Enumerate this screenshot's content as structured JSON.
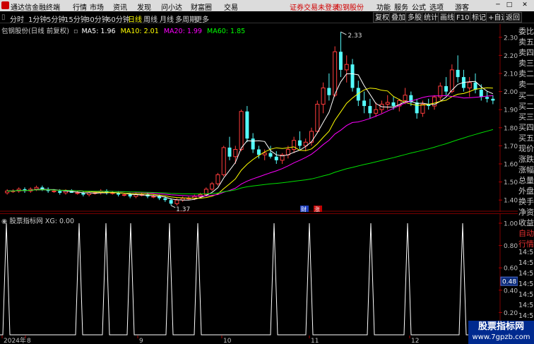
{
  "app": {
    "title": "通达信金融终端",
    "menu": [
      "行情",
      "市场",
      "资讯",
      "发现",
      "问小达",
      "财富圈",
      "交易"
    ],
    "login_notice": "证券交易未登录",
    "stock_name": "包钢股份",
    "right_menu": [
      "功能",
      "服务",
      "公式",
      "选项"
    ],
    "user": "游客"
  },
  "periods": {
    "items": [
      "分时",
      "1分钟",
      "5分钟",
      "15分钟",
      "30分钟",
      "60分钟",
      "日线",
      "周线",
      "月线",
      "多周期",
      "更多"
    ],
    "active": "日线"
  },
  "toolbar": {
    "buttons": [
      "复权",
      "叠加",
      "多股",
      "统计",
      "画线",
      "F10",
      "标记",
      "+自选",
      "返回"
    ]
  },
  "main_chart": {
    "title": "包钢股份(日线 前复权)",
    "ma_labels": [
      {
        "text": "MA5: 1.96",
        "color": "#ffffff"
      },
      {
        "text": "MA10: 2.01",
        "color": "#ffff00"
      },
      {
        "text": "MA20: 1.99",
        "color": "#ff00ff"
      },
      {
        "text": "MA60: 1.85",
        "color": "#00ff00"
      }
    ],
    "y_ticks": [
      "2.30",
      "2.20",
      "2.10",
      "2.00",
      "1.90",
      "1.80",
      "1.70",
      "1.60",
      "1.50",
      "1.40"
    ],
    "high_marker": "2.33",
    "low_marker": "1.37",
    "badge_cai": "财",
    "badge_zhang": "涨"
  },
  "indicator": {
    "title": "股票指标网  XG: 0.00",
    "y_ticks": [
      "1.00",
      "0.80",
      "0.60",
      "0.40",
      "0.20",
      "0.00"
    ],
    "value_box": "0.48"
  },
  "x_axis": {
    "labels": [
      "2024年",
      "8",
      "9",
      "10",
      "11",
      "12"
    ]
  },
  "right_panel": {
    "labels": [
      "委比",
      "卖五",
      "卖四",
      "卖三",
      "卖二",
      "卖一",
      "买一",
      "买二",
      "买三",
      "买四",
      "买五",
      "现价",
      "涨跌",
      "涨幅",
      "总量",
      "外盘",
      "换手",
      "净资",
      "收益",
      "自动",
      "行情",
      "14:56",
      "14:56",
      "14:56",
      "14:56",
      "14:56",
      "14:56",
      "14:56",
      "14:56"
    ]
  },
  "watermark": {
    "line1": "股票指标网",
    "line2": "www.7gpzb.com"
  },
  "chart_data": {
    "type": "candlestick",
    "title": "包钢股份(日线 前复权)",
    "ylim": [
      1.35,
      2.35
    ],
    "candles": [
      [
        1.44,
        1.46,
        1.43,
        1.45
      ],
      [
        1.45,
        1.46,
        1.44,
        1.45
      ],
      [
        1.45,
        1.47,
        1.44,
        1.46
      ],
      [
        1.46,
        1.47,
        1.44,
        1.45
      ],
      [
        1.45,
        1.47,
        1.44,
        1.46
      ],
      [
        1.46,
        1.48,
        1.45,
        1.47
      ],
      [
        1.47,
        1.48,
        1.45,
        1.46
      ],
      [
        1.46,
        1.47,
        1.44,
        1.45
      ],
      [
        1.45,
        1.46,
        1.44,
        1.45
      ],
      [
        1.45,
        1.46,
        1.43,
        1.44
      ],
      [
        1.44,
        1.46,
        1.43,
        1.45
      ],
      [
        1.45,
        1.46,
        1.44,
        1.44
      ],
      [
        1.44,
        1.45,
        1.43,
        1.44
      ],
      [
        1.44,
        1.45,
        1.42,
        1.43
      ],
      [
        1.43,
        1.45,
        1.42,
        1.44
      ],
      [
        1.44,
        1.45,
        1.43,
        1.44
      ],
      [
        1.44,
        1.46,
        1.43,
        1.45
      ],
      [
        1.45,
        1.46,
        1.43,
        1.44
      ],
      [
        1.44,
        1.45,
        1.43,
        1.44
      ],
      [
        1.44,
        1.45,
        1.42,
        1.43
      ],
      [
        1.43,
        1.44,
        1.42,
        1.43
      ],
      [
        1.43,
        1.44,
        1.41,
        1.42
      ],
      [
        1.42,
        1.44,
        1.41,
        1.43
      ],
      [
        1.43,
        1.44,
        1.42,
        1.43
      ],
      [
        1.43,
        1.44,
        1.41,
        1.42
      ],
      [
        1.42,
        1.43,
        1.41,
        1.42
      ],
      [
        1.42,
        1.43,
        1.4,
        1.41
      ],
      [
        1.41,
        1.42,
        1.39,
        1.4
      ],
      [
        1.4,
        1.41,
        1.37,
        1.38
      ],
      [
        1.38,
        1.41,
        1.37,
        1.4
      ],
      [
        1.4,
        1.42,
        1.39,
        1.41
      ],
      [
        1.41,
        1.42,
        1.4,
        1.41
      ],
      [
        1.41,
        1.43,
        1.4,
        1.42
      ],
      [
        1.42,
        1.44,
        1.41,
        1.43
      ],
      [
        1.43,
        1.47,
        1.42,
        1.46
      ],
      [
        1.46,
        1.5,
        1.45,
        1.49
      ],
      [
        1.49,
        1.55,
        1.48,
        1.54
      ],
      [
        1.54,
        1.7,
        1.53,
        1.69
      ],
      [
        1.69,
        1.75,
        1.62,
        1.64
      ],
      [
        1.64,
        1.7,
        1.6,
        1.68
      ],
      [
        1.68,
        1.9,
        1.67,
        1.89
      ],
      [
        1.89,
        1.92,
        1.72,
        1.74
      ],
      [
        1.74,
        1.77,
        1.66,
        1.68
      ],
      [
        1.68,
        1.7,
        1.63,
        1.65
      ],
      [
        1.65,
        1.68,
        1.62,
        1.66
      ],
      [
        1.66,
        1.7,
        1.63,
        1.64
      ],
      [
        1.64,
        1.67,
        1.6,
        1.62
      ],
      [
        1.62,
        1.66,
        1.6,
        1.65
      ],
      [
        1.65,
        1.7,
        1.63,
        1.68
      ],
      [
        1.68,
        1.75,
        1.66,
        1.73
      ],
      [
        1.73,
        1.78,
        1.68,
        1.7
      ],
      [
        1.7,
        1.74,
        1.67,
        1.72
      ],
      [
        1.72,
        1.8,
        1.7,
        1.78
      ],
      [
        1.78,
        1.95,
        1.77,
        1.93
      ],
      [
        1.93,
        2.05,
        1.88,
        2.02
      ],
      [
        2.02,
        2.1,
        1.95,
        1.98
      ],
      [
        1.98,
        2.25,
        1.97,
        2.22
      ],
      [
        2.22,
        2.33,
        2.08,
        2.12
      ],
      [
        2.12,
        2.2,
        2.05,
        2.15
      ],
      [
        2.15,
        2.18,
        2.0,
        2.02
      ],
      [
        2.02,
        2.06,
        1.92,
        1.95
      ],
      [
        1.95,
        2.0,
        1.88,
        1.92
      ],
      [
        1.92,
        1.96,
        1.85,
        1.88
      ],
      [
        1.88,
        1.94,
        1.86,
        1.9
      ],
      [
        1.9,
        1.95,
        1.88,
        1.93
      ],
      [
        1.93,
        1.98,
        1.9,
        1.94
      ],
      [
        1.94,
        1.97,
        1.9,
        1.92
      ],
      [
        1.92,
        1.96,
        1.89,
        1.95
      ],
      [
        1.95,
        2.02,
        1.93,
        1.98
      ],
      [
        1.98,
        2.0,
        1.92,
        1.94
      ],
      [
        1.94,
        1.96,
        1.85,
        1.88
      ],
      [
        1.88,
        1.95,
        1.86,
        1.93
      ],
      [
        1.93,
        1.96,
        1.9,
        1.92
      ],
      [
        1.92,
        1.98,
        1.9,
        1.97
      ],
      [
        1.97,
        2.05,
        1.95,
        2.03
      ],
      [
        2.03,
        2.08,
        1.98,
        2.0
      ],
      [
        2.0,
        2.15,
        1.99,
        2.12
      ],
      [
        2.12,
        2.2,
        2.05,
        2.08
      ],
      [
        2.08,
        2.12,
        2.0,
        2.02
      ],
      [
        2.02,
        2.08,
        1.97,
        2.05
      ],
      [
        2.05,
        2.1,
        1.99,
        2.01
      ],
      [
        2.01,
        2.04,
        1.95,
        1.97
      ],
      [
        1.97,
        2.0,
        1.94,
        1.96
      ],
      [
        1.96,
        1.98,
        1.93,
        1.95
      ]
    ],
    "indicator_spikes_x": [
      9,
      112,
      150,
      185,
      240,
      280,
      388,
      438,
      525,
      577,
      655
    ]
  }
}
